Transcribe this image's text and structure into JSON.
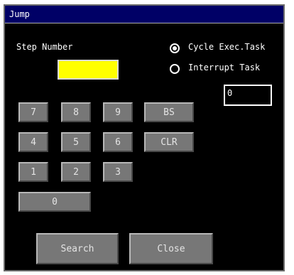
{
  "window": {
    "title": "Jump"
  },
  "step_number": {
    "label": "Step Number"
  },
  "task_type": {
    "options": [
      {
        "label": "Cycle Exec.Task",
        "selected": true
      },
      {
        "label": "Interrupt Task",
        "selected": false
      }
    ]
  },
  "field": {
    "value": "0"
  },
  "keypad": {
    "keys": [
      "7",
      "8",
      "9",
      "BS",
      "4",
      "5",
      "6",
      "CLR",
      "1",
      "2",
      "3",
      "0"
    ]
  },
  "buttons": {
    "search": "Search",
    "close": "Close"
  },
  "colors": {
    "title_bar": "#000066",
    "background": "#000000",
    "step_field": "#ffff00",
    "key": "#777777"
  }
}
